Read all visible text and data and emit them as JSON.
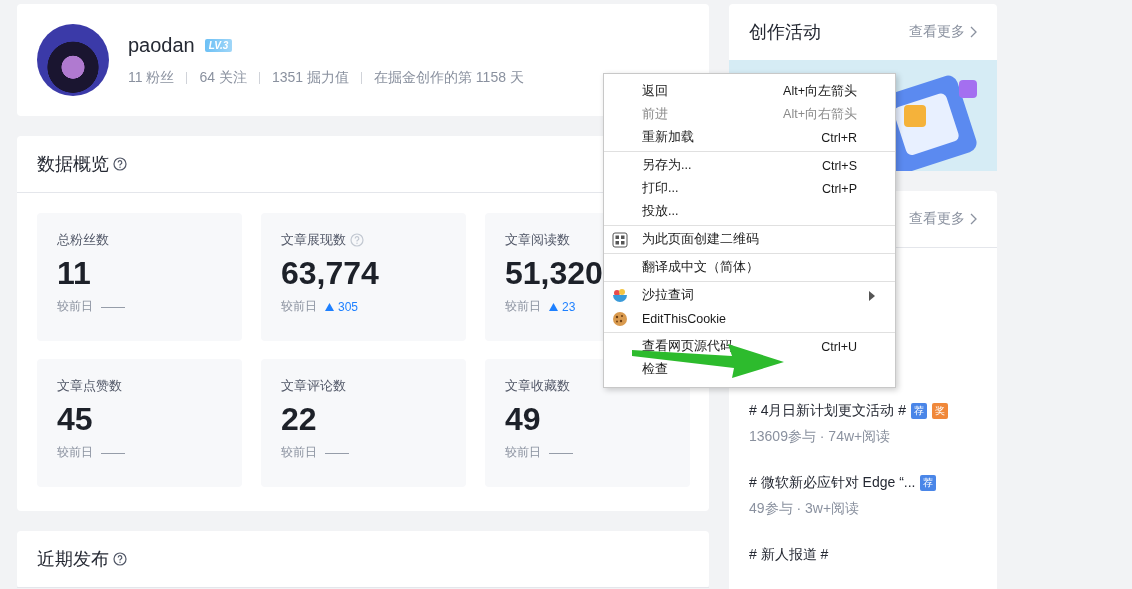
{
  "profile": {
    "name": "paodan",
    "level_badge": "LV.3",
    "stats": [
      "11 粉丝",
      "64 关注",
      "1351 掘力值",
      "在掘金创作的第 1158 天"
    ]
  },
  "overview": {
    "title": "数据概览",
    "cards": [
      {
        "label": "总粉丝数",
        "help": false,
        "value": "11",
        "compare": "较前日",
        "change": "——",
        "rising": false
      },
      {
        "label": "文章展现数",
        "help": true,
        "value": "63,774",
        "compare": "较前日",
        "change": "305",
        "rising": true
      },
      {
        "label": "文章阅读数",
        "help": false,
        "value": "51,320",
        "compare": "较前日",
        "change": "23",
        "rising": true
      },
      {
        "label": "文章点赞数",
        "help": false,
        "value": "45",
        "compare": "较前日",
        "change": "——",
        "rising": false
      },
      {
        "label": "文章评论数",
        "help": false,
        "value": "22",
        "compare": "较前日",
        "change": "——",
        "rising": false
      },
      {
        "label": "文章收藏数",
        "help": false,
        "value": "49",
        "compare": "较前日",
        "change": "——",
        "rising": false
      }
    ]
  },
  "recent": {
    "title": "近期发布"
  },
  "activity": {
    "title": "创作活动",
    "more": "查看更多"
  },
  "topics": {
    "more": "查看更多",
    "items": [
      {
        "title": "# 4月日新计划更文活动 #",
        "tags": [
          {
            "text": "荐",
            "color": "#4a86e8"
          },
          {
            "text": "奖",
            "color": "#f0883a"
          }
        ],
        "meta": "13609参与 · 74w+阅读"
      },
      {
        "title": "# 微软新必应针对 Edge “...",
        "tags": [
          {
            "text": "荐",
            "color": "#4a86e8"
          }
        ],
        "meta": "49参与 · 3w+阅读"
      },
      {
        "title": "# 新人报道 #"
      }
    ]
  },
  "context_menu": {
    "groups": [
      [
        {
          "label": "返回",
          "shortcut": "Alt+向左箭头",
          "disabled": false,
          "kind": "plain",
          "submenu": false
        },
        {
          "label": "前进",
          "shortcut": "Alt+向右箭头",
          "disabled": true,
          "kind": "plain",
          "submenu": false
        },
        {
          "label": "重新加载",
          "shortcut": "Ctrl+R",
          "disabled": false,
          "kind": "plain",
          "submenu": false
        }
      ],
      [
        {
          "label": "另存为...",
          "shortcut": "Ctrl+S",
          "disabled": false,
          "kind": "plain",
          "submenu": false
        },
        {
          "label": "打印...",
          "shortcut": "Ctrl+P",
          "disabled": false,
          "kind": "plain",
          "submenu": false
        },
        {
          "label": "投放...",
          "disabled": false,
          "kind": "plain",
          "submenu": false
        }
      ],
      [
        {
          "label": "为此页面创建二维码",
          "disabled": false,
          "kind": "qrcode",
          "submenu": false
        }
      ],
      [
        {
          "label": "翻译成中文（简体）",
          "disabled": false,
          "kind": "plain",
          "submenu": false
        }
      ],
      [
        {
          "label": "沙拉查词",
          "disabled": false,
          "kind": "extension",
          "submenu": true
        },
        {
          "label": "EditThisCookie",
          "disabled": false,
          "kind": "cookie",
          "submenu": false
        }
      ],
      [
        {
          "label": "查看网页源代码",
          "shortcut": "Ctrl+U",
          "disabled": false,
          "kind": "plain",
          "submenu": false
        },
        {
          "label": "检查",
          "disabled": false,
          "kind": "plain",
          "submenu": false
        }
      ]
    ]
  }
}
